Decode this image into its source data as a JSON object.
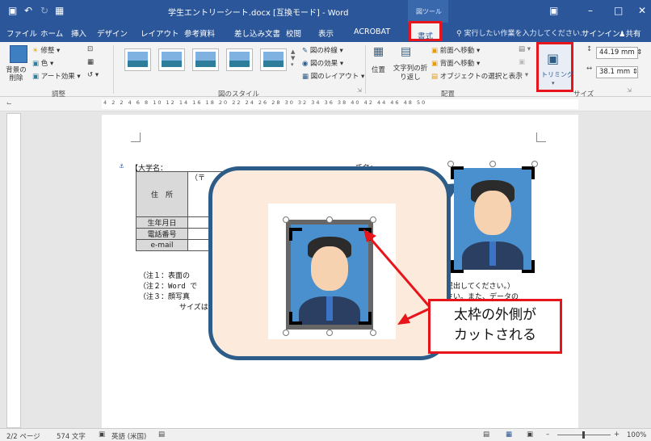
{
  "title_bar": {
    "title": "学生エントリーシート.docx [互換モード] - Word",
    "context_group": "図ツール",
    "save_icon": "save-icon",
    "undo_icon": "undo-icon",
    "redo_icon": "redo-icon",
    "print_preview_icon": "print-preview-icon"
  },
  "tabs": [
    "ファイル",
    "ホーム",
    "挿入",
    "デザイン",
    "レイアウト",
    "参考資料",
    "差し込み文書",
    "校閲",
    "表示",
    "ACROBAT",
    "書式"
  ],
  "tell_me": "実行したい作業を入力してください...",
  "account": {
    "signin": "サインイン",
    "share": "共有"
  },
  "ribbon": {
    "adjust": {
      "remove_bg": "背景の削除",
      "corrections": "修整",
      "color": "色",
      "artistic": "アート効果",
      "group": "調整"
    },
    "styles": {
      "group": "図のスタイル",
      "border": "図の枠線",
      "effects": "図の効果",
      "layout": "図のレイアウト"
    },
    "arrange": {
      "position": "位置",
      "wrap": "文字列の折り返し",
      "bring_forward": "前面へ移動",
      "send_backward": "背面へ移動",
      "selection_pane": "オブジェクトの選択と表示",
      "group": "配置"
    },
    "size": {
      "crop": "トリミング",
      "height": "44.19 mm",
      "width": "38.1 mm",
      "group": "サイズ"
    }
  },
  "ruler": {
    "marks": "4 2 2 4 6 8 10 12 14 16 18 20 22 24 26 28 30 32 34 36 38 40 42 44 46 48 50"
  },
  "document": {
    "university_label": "【大学名：",
    "name_label": "氏名：",
    "table_rows": [
      {
        "header": "住　所",
        "value": "（〒"
      },
      {
        "header": "生年月日",
        "value": ""
      },
      {
        "header": "電話番号",
        "value": ""
      },
      {
        "header": "e-mail",
        "value": ""
      }
    ],
    "notes": [
      "（注１：表面の",
      "（注２：Word で",
      "（注３：顔写真",
      "サイズは"
    ],
    "note_right_1": "提出してください。）",
    "note_right_2": "さい。また、データの"
  },
  "callout_text": [
    "太枠の外側が",
    "カットされる"
  ],
  "statusbar": {
    "page": "2/2 ページ",
    "words": "574 文字",
    "language": "英語 (米国)",
    "zoom": "100%"
  }
}
